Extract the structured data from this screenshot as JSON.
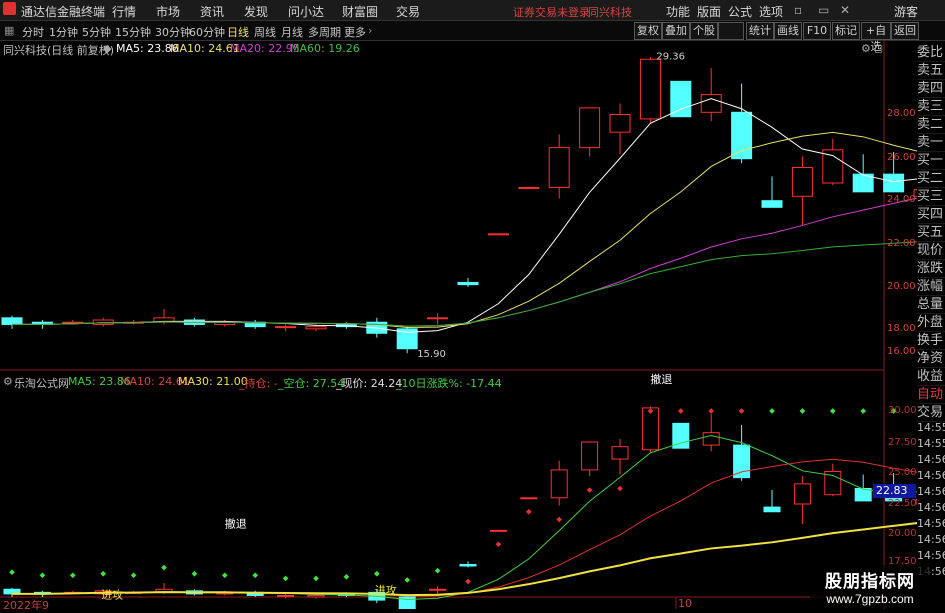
{
  "menu": {
    "app_title": "通达信金融终端",
    "items": [
      "行情",
      "市场",
      "资讯",
      "发现",
      "问小达",
      "财富圈",
      "交易"
    ],
    "notice": "证券交易未登录",
    "stock_name": "同兴科技",
    "right_items": [
      "功能",
      "版面",
      "公式",
      "选项"
    ],
    "guest": "游客"
  },
  "tabs": {
    "periods": [
      "分时",
      "1分钟",
      "5分钟",
      "15分钟",
      "30分钟",
      "60分钟",
      "日线",
      "周线",
      "月线",
      "多周期",
      "更多"
    ],
    "active_period": "日线",
    "buttons": [
      "复权",
      "叠加",
      "个股",
      "统计",
      "画线",
      "F10",
      "标记",
      "+自选",
      "返回"
    ]
  },
  "main_panel": {
    "title": "同兴科技(日线 前复权)",
    "ma_labels": [
      {
        "text": "MA5: 23.86",
        "color": "#ffffff"
      },
      {
        "text": "MA10: 24.61",
        "color": "#e8e060"
      },
      {
        "text": "MA20: 22.95",
        "color": "#d040d0"
      },
      {
        "text": "MA60: 19.26",
        "color": "#40c040"
      }
    ],
    "high_label": "29.36",
    "low_label": "15.90",
    "y_axis": [
      "28.00",
      "26.00",
      "24.00",
      "22.00",
      "20.00",
      "18.00",
      "16.00"
    ]
  },
  "indicator_panel": {
    "title": "乐淘公式网",
    "labels": [
      {
        "text": "MA5: 23.86",
        "color": "#40d040"
      },
      {
        "text": "MA10: 24.61",
        "color": "#e04040"
      },
      {
        "text": "MA30: 21.00",
        "color": "#f0e040"
      },
      {
        "text": "_持仓: -",
        "color": "#e04040"
      },
      {
        "text": "_空仓: 27.54",
        "color": "#40d040"
      },
      {
        "text": "_现价: 24.24",
        "color": "#e0e0e0"
      },
      {
        "text": "_10日涨跌%: -17.44",
        "color": "#40d040"
      }
    ],
    "signals": {
      "retreat1": "撤退",
      "retreat2": "撤退",
      "attack1": "进攻",
      "attack2": "进攻"
    },
    "y_axis": [
      "30.00",
      "27.50",
      "25.00",
      "22.50",
      "20.00",
      "17.50"
    ],
    "current_price_tag": "22.83"
  },
  "right_panel": {
    "items": [
      "委比",
      "卖五",
      "卖四",
      "卖三",
      "卖二",
      "卖一",
      "买一",
      "买二",
      "买三",
      "买四",
      "买五",
      "现价",
      "涨跌",
      "涨幅",
      "总量",
      "外盘",
      "换手",
      "净资",
      "收益"
    ],
    "bottom_items": [
      "自动",
      "交易"
    ],
    "times": [
      "14:55",
      "14:55",
      "14:56",
      "14:56",
      "14:56",
      "14:56",
      "14:56",
      "14:56",
      "14:56",
      "14:56"
    ]
  },
  "x_axis": {
    "start": "2022年9",
    "mid": "10"
  },
  "watermark": {
    "line1": "股朋指标网",
    "line2": "www.7gpzb.com"
  },
  "chart_data": {
    "type": "candlestick",
    "candles": [
      [
        17.5,
        17.6,
        17.0,
        17.2
      ],
      [
        17.3,
        17.4,
        17.0,
        17.2
      ],
      [
        17.3,
        17.4,
        17.2,
        17.3
      ],
      [
        17.2,
        17.5,
        17.1,
        17.4
      ],
      [
        17.3,
        17.4,
        17.2,
        17.3
      ],
      [
        17.3,
        17.9,
        17.2,
        17.5
      ],
      [
        17.4,
        17.5,
        17.1,
        17.2
      ],
      [
        17.2,
        17.4,
        17.1,
        17.3
      ],
      [
        17.3,
        17.4,
        17.0,
        17.1
      ],
      [
        17.1,
        17.2,
        16.9,
        17.1
      ],
      [
        17.0,
        17.2,
        16.9,
        17.1
      ],
      [
        17.2,
        17.3,
        17.0,
        17.1
      ],
      [
        17.3,
        17.5,
        16.6,
        16.8
      ],
      [
        17.0,
        17.1,
        15.9,
        16.1
      ],
      [
        17.5,
        17.7,
        17.2,
        17.5
      ],
      [
        19.1,
        19.3,
        18.9,
        19.0
      ],
      [
        21.3,
        21.3,
        21.3,
        21.3
      ],
      [
        23.4,
        23.4,
        23.4,
        23.4
      ],
      [
        23.4,
        25.8,
        22.9,
        25.2
      ],
      [
        25.2,
        26.6,
        24.8,
        27.0
      ],
      [
        25.9,
        27.2,
        24.9,
        26.7
      ],
      [
        26.5,
        29.3,
        26.3,
        29.2
      ],
      [
        28.2,
        28.2,
        26.6,
        26.6
      ],
      [
        26.8,
        28.8,
        26.4,
        27.6
      ],
      [
        26.8,
        28.1,
        24.5,
        24.7
      ],
      [
        22.8,
        23.9,
        22.6,
        22.5
      ],
      [
        23.0,
        24.8,
        21.7,
        24.3
      ],
      [
        23.6,
        25.6,
        23.5,
        25.1
      ],
      [
        24.0,
        24.9,
        23.3,
        23.2
      ],
      [
        24.0,
        25.0,
        23.3,
        23.2
      ],
      [
        23.0,
        23.6,
        22.7,
        23.3
      ],
      [
        23.3,
        25.0,
        23.1,
        24.2
      ]
    ],
    "ma5": 23.86,
    "ma10": 24.61,
    "ma20": 22.95,
    "ma60": 19.26,
    "ylim": [
      15.5,
      29.8
    ],
    "ind_ylim": [
      17.0,
      31.0
    ]
  }
}
